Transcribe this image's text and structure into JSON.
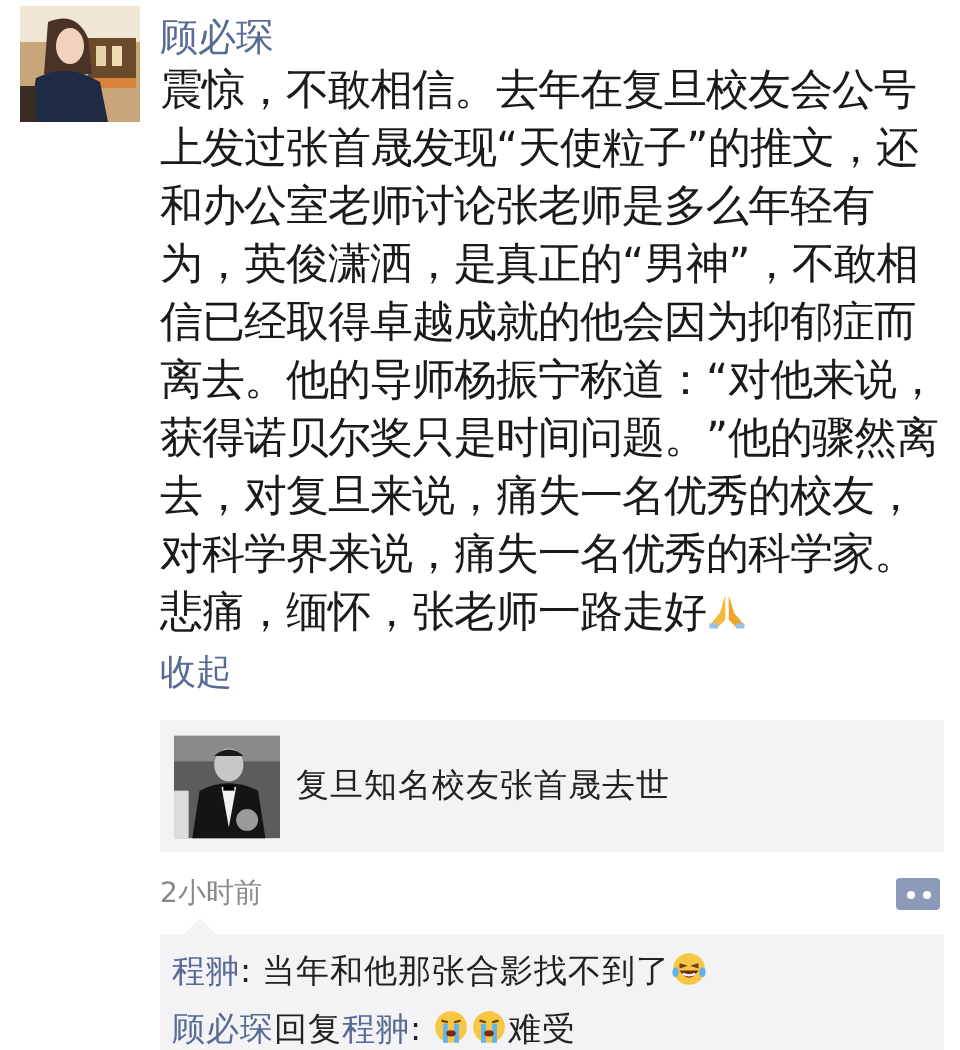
{
  "post": {
    "author": "顾必琛",
    "body": [
      {
        "kind": "text",
        "text": "震惊，不敢相信。去年在复旦校友会公号上发过张首晟发现“天使粒子”的推文，还和办公室老师讨论张老师是多么年轻有为，英俊潇洒，是真正的“男神”，不敢相信已经取得卓越成就的他会因为抑郁症而离去。他的导师杨振宁称道：“对他来说，获得诺贝尔奖只是时间问题。”他的骤然离去，对复旦来说，痛失一名优秀的校友，对科学界来说，痛失一名优秀的科学家。悲痛，缅怀，张老师一路走好"
      },
      {
        "kind": "pray"
      }
    ],
    "collapse_link": "收起",
    "shared_link": {
      "title": "复旦知名校友张首晟去世"
    },
    "time": "2小时前"
  },
  "comments": [
    {
      "parts": [
        {
          "kind": "name",
          "text": "程翀"
        },
        {
          "kind": "text",
          "text": ": 当年和他那张合影找不到了"
        },
        {
          "kind": "laughing"
        }
      ]
    },
    {
      "parts": [
        {
          "kind": "name",
          "text": "顾必琛"
        },
        {
          "kind": "text",
          "text": "回复"
        },
        {
          "kind": "name",
          "text": "程翀"
        },
        {
          "kind": "text",
          "text": ": "
        },
        {
          "kind": "crying"
        },
        {
          "kind": "crying"
        },
        {
          "kind": "text",
          "text": "难受"
        }
      ]
    }
  ]
}
